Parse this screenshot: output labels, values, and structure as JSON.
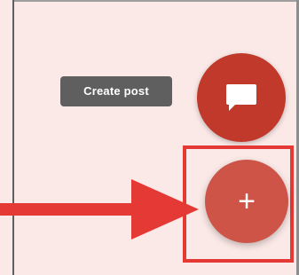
{
  "tooltip": {
    "label": "Create post"
  },
  "fab_main": {
    "label": "+",
    "icon": "plus-icon"
  },
  "fab_mini": {
    "icon": "chat-bubble-icon"
  },
  "annotation": {
    "arrow_color": "#e53935",
    "box_color": "#e53935"
  },
  "colors": {
    "background": "#fbe9e7",
    "fab_mini": "#c0392b",
    "fab_main": "#cd5447",
    "tooltip": "#5f5f5f"
  }
}
